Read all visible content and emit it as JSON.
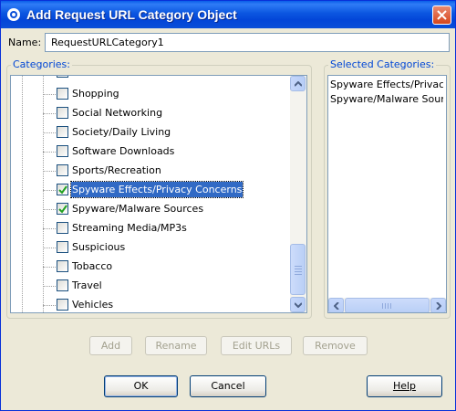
{
  "window": {
    "title": "Add Request URL Category Object",
    "title_icon": "dialog-app-icon",
    "close_icon": "close-icon"
  },
  "name_field": {
    "label": "Name:",
    "value": "RequestURLCategory1"
  },
  "categories": {
    "label": "Categories:",
    "items": [
      {
        "label": "Shopping",
        "checked": false,
        "selected": false
      },
      {
        "label": "Social Networking",
        "checked": false,
        "selected": false
      },
      {
        "label": "Society/Daily Living",
        "checked": false,
        "selected": false
      },
      {
        "label": "Software Downloads",
        "checked": false,
        "selected": false
      },
      {
        "label": "Sports/Recreation",
        "checked": false,
        "selected": false
      },
      {
        "label": "Spyware Effects/Privacy Concerns",
        "checked": true,
        "selected": true
      },
      {
        "label": "Spyware/Malware Sources",
        "checked": true,
        "selected": false
      },
      {
        "label": "Streaming Media/MP3s",
        "checked": false,
        "selected": false
      },
      {
        "label": "Suspicious",
        "checked": false,
        "selected": false
      },
      {
        "label": "Tobacco",
        "checked": false,
        "selected": false
      },
      {
        "label": "Travel",
        "checked": false,
        "selected": false
      },
      {
        "label": "Vehicles",
        "checked": false,
        "selected": false
      }
    ]
  },
  "selected_categories": {
    "label": "Selected Categories:",
    "items": [
      "Spyware Effects/Privacy Concerns",
      "Spyware/Malware Sources"
    ]
  },
  "action_buttons": {
    "add": "Add",
    "rename": "Rename",
    "edit_urls": "Edit URLs",
    "remove": "Remove"
  },
  "dialog_buttons": {
    "ok": "OK",
    "cancel": "Cancel",
    "help": "Help"
  },
  "colors": {
    "titlebar": "#0a4fd8",
    "selection": "#316ac5",
    "checkmark": "#21a121",
    "group_label": "#0046d5"
  }
}
